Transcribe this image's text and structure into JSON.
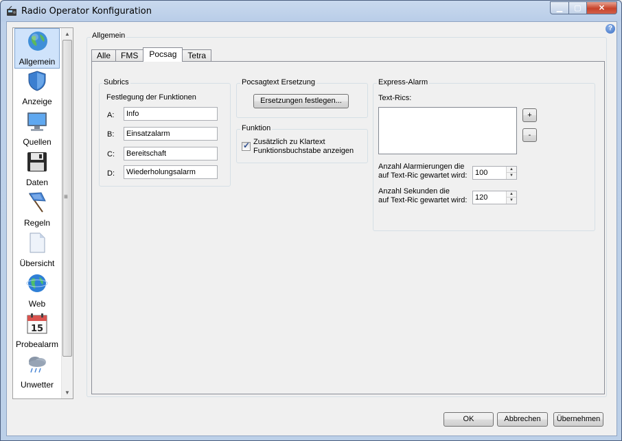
{
  "window": {
    "title": "Radio Operator Konfiguration",
    "controls": {
      "minimize": "▁",
      "maximize": "▢",
      "close": "✕"
    }
  },
  "sidebar": {
    "items": [
      {
        "label": "Allgemein",
        "icon": "globe-icon",
        "selected": true
      },
      {
        "label": "Anzeige",
        "icon": "shield-icon"
      },
      {
        "label": "Quellen",
        "icon": "monitor-icon"
      },
      {
        "label": "Daten",
        "icon": "floppy-icon"
      },
      {
        "label": "Regeln",
        "icon": "flag-icon"
      },
      {
        "label": "Übersicht",
        "icon": "document-icon"
      },
      {
        "label": "Web",
        "icon": "web-globe-icon"
      },
      {
        "label": "Probealarm",
        "icon": "calendar-icon",
        "day": "15"
      },
      {
        "label": "Unwetter",
        "icon": "storm-cloud-icon"
      }
    ],
    "scroll_up": "▲",
    "scroll_down": "▼",
    "splitter_grip": "≡"
  },
  "general": {
    "group_label": "Allgemein",
    "help": "?",
    "tabs": [
      "Alle",
      "FMS",
      "Pocsag",
      "Tetra"
    ],
    "active_tab": "Pocsag"
  },
  "subrics": {
    "group_label": "Subrics",
    "heading": "Festlegung der Funktionen",
    "rows": [
      {
        "key": "A:",
        "value": "Info"
      },
      {
        "key": "B:",
        "value": "Einsatzalarm"
      },
      {
        "key": "C:",
        "value": "Bereitschaft"
      },
      {
        "key": "D:",
        "value": "Wiederholungsalarm"
      }
    ]
  },
  "pocsagtext": {
    "group_label": "Pocsagtext Ersetzung",
    "button": "Ersetzungen festlegen..."
  },
  "funktion": {
    "group_label": "Funktion",
    "checkbox_checked": true,
    "checkbox_mark": "✓",
    "checkbox_line1": "Zusätzlich zu Klartext",
    "checkbox_line2": "Funktionsbuchstabe anzeigen"
  },
  "express": {
    "group_label": "Express-Alarm",
    "text_rics_label": "Text-Rics:",
    "add_button": "+",
    "remove_button": "-",
    "alarm_count_line1": "Anzahl Alarmierungen die",
    "alarm_count_line2": "auf Text-Ric gewartet wird:",
    "alarm_count_value": "100",
    "seconds_line1": "Anzahl Sekunden die",
    "seconds_line2": "auf Text-Ric gewartet wird:",
    "seconds_value": "120",
    "spin_up": "▲",
    "spin_down": "▼"
  },
  "footer": {
    "ok": "OK",
    "cancel": "Abbrechen",
    "apply": "Übernehmen"
  },
  "colors": {
    "selection": "#cfe3fb",
    "titlebar": "#bdd0e9",
    "close": "#c7432a"
  }
}
